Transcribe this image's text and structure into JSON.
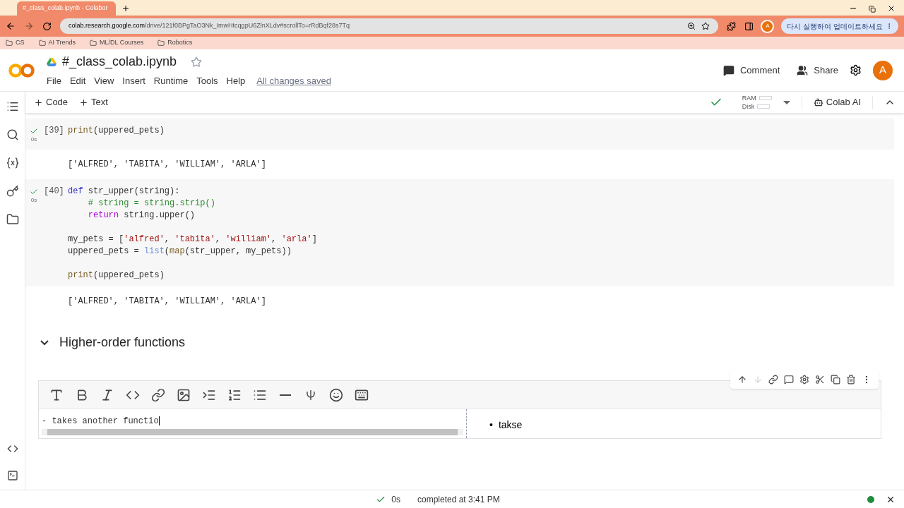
{
  "browser": {
    "tab_title": "#_class_colab.ipynb - Colabor",
    "url_host": "colab.research.google.com",
    "url_path": "/drive/121f0BPgTaO3Nk_ImwHtcqgpU6ZlnXLdv#scrollTo=rRdBqf28s7Tq",
    "profile_initial": "A",
    "update_button": "다시 실행하여 업데이트하세요",
    "bookmarks": [
      "CS",
      "AI Trends",
      "ML/DL Courses",
      "Robotics"
    ]
  },
  "notebook": {
    "title": "#_class_colab.ipynb",
    "starred": false,
    "menu": [
      "File",
      "Edit",
      "View",
      "Insert",
      "Runtime",
      "Tools",
      "Help"
    ],
    "save_status": "All changes saved",
    "comment": "Comment",
    "share": "Share",
    "avatar": "A"
  },
  "toolbar": {
    "add_code": "Code",
    "add_text": "Text",
    "ram": "RAM",
    "disk": "Disk",
    "colab_ai": "Colab AI"
  },
  "cells": [
    {
      "kind": "code",
      "count": "[39]",
      "time": "0s",
      "blocks": [
        [
          [
            {
              "t": "print",
              "kind": "builtin"
            },
            {
              "t": "(uppered_pets)",
              "kind": "plain"
            }
          ]
        ]
      ],
      "output": "['ALFRED', 'TABITA', 'WILLIAM', 'ARLA']"
    },
    {
      "kind": "code",
      "count": "[40]",
      "time": "0s",
      "blocks": [
        [
          [
            {
              "t": "def ",
              "kind": "keyword"
            },
            {
              "t": "str_upper",
              "kind": "plain"
            },
            {
              "t": "(string):",
              "kind": "plain"
            }
          ],
          [
            {
              "t": "    # string = string.strip()",
              "kind": "comment"
            }
          ],
          [
            {
              "t": "    return",
              "kind": "control"
            },
            {
              "t": " string.upper()",
              "kind": "plain"
            }
          ]
        ],
        [
          [
            {
              "t": "my_pets = [",
              "kind": "plain"
            },
            {
              "t": "'alfred'",
              "kind": "string"
            },
            {
              "t": ", ",
              "kind": "plain"
            },
            {
              "t": "'tabita'",
              "kind": "string"
            },
            {
              "t": ", ",
              "kind": "plain"
            },
            {
              "t": "'william'",
              "kind": "string"
            },
            {
              "t": ", ",
              "kind": "plain"
            },
            {
              "t": "'arla'",
              "kind": "string"
            },
            {
              "t": "]",
              "kind": "plain"
            }
          ],
          [
            {
              "t": "uppered_pets = ",
              "kind": "plain"
            },
            {
              "t": "list",
              "kind": "type"
            },
            {
              "t": "(",
              "kind": "plain"
            },
            {
              "t": "map",
              "kind": "builtin"
            },
            {
              "t": "(str_upper, my_pets))",
              "kind": "plain"
            }
          ]
        ],
        [
          [
            {
              "t": "print",
              "kind": "builtin"
            },
            {
              "t": "(uppered_pets)",
              "kind": "plain"
            }
          ]
        ]
      ],
      "output": "['ALFRED', 'TABITA', 'WILLIAM', 'ARLA']"
    },
    {
      "kind": "heading",
      "text": "Higher-order functions",
      "expanded": true
    },
    {
      "kind": "text_edit",
      "source": "- takes another functio",
      "preview": [
        {
          "marker": "•",
          "text": "takse"
        }
      ]
    }
  ],
  "status": {
    "time": "0s",
    "message": "completed at 3:41 PM"
  }
}
